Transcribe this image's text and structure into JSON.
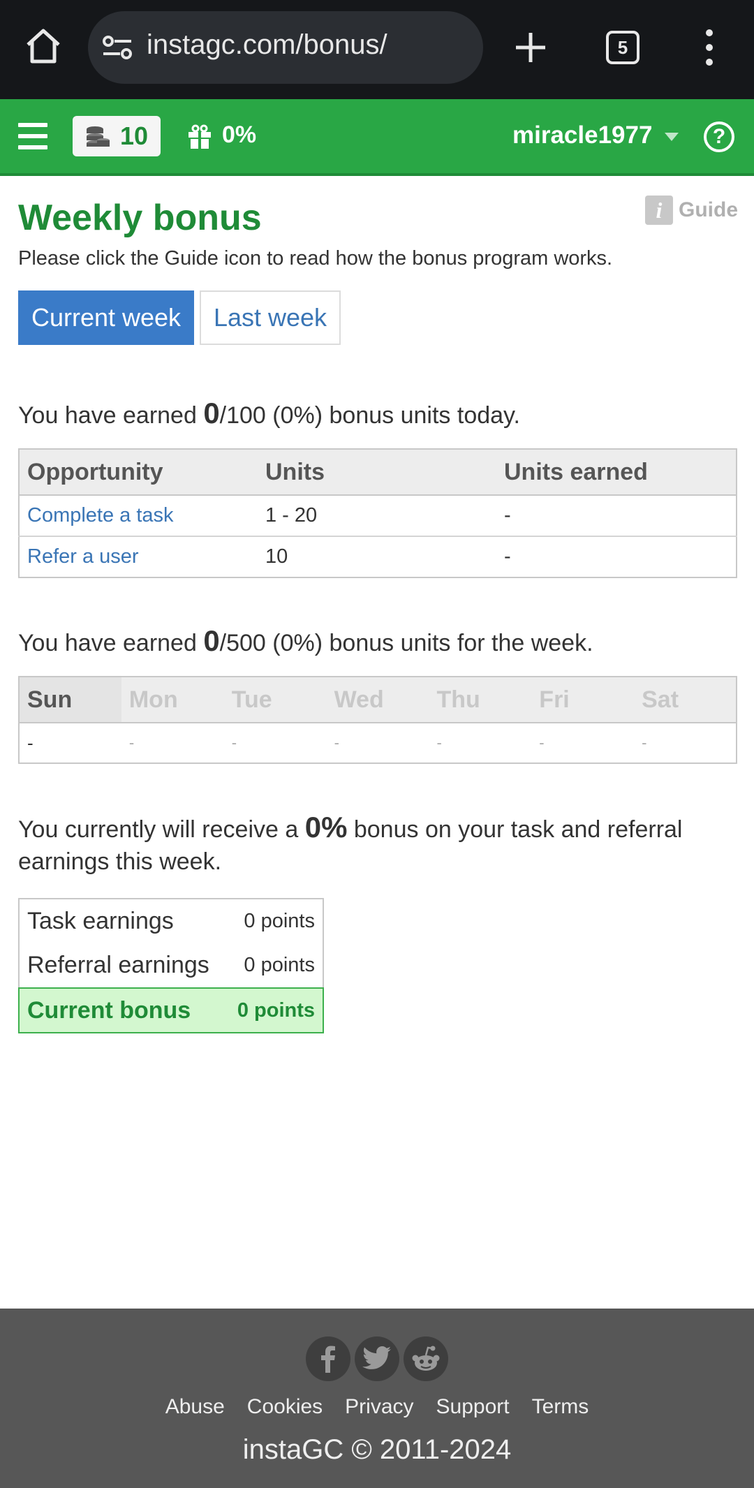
{
  "browser": {
    "url": "instagc.com/bonus/",
    "tab_count": "5"
  },
  "header": {
    "balance": "10",
    "bonus_percent": "0%",
    "username": "miracle1977",
    "help_symbol": "?"
  },
  "page": {
    "title": "Weekly bonus",
    "guide_icon_letter": "i",
    "guide_label": "Guide",
    "intro": "Please click the Guide icon to read how the bonus program works.",
    "tabs": [
      {
        "label": "Current week",
        "active": true
      },
      {
        "label": "Last week",
        "active": false
      }
    ]
  },
  "daily": {
    "prefix": "You have earned ",
    "earned": "0",
    "suffix": "/100 (0%) bonus units today.",
    "headers": [
      "Opportunity",
      "Units",
      "Units earned"
    ],
    "rows": [
      {
        "opportunity": "Complete a task",
        "units": "1 - 20",
        "earned": "-"
      },
      {
        "opportunity": "Refer a user",
        "units": "10",
        "earned": "-"
      }
    ]
  },
  "weekly": {
    "prefix": "You have earned ",
    "earned": "0",
    "suffix": "/500 (0%) bonus units for the week.",
    "days": [
      "Sun",
      "Mon",
      "Tue",
      "Wed",
      "Thu",
      "Fri",
      "Sat"
    ],
    "values": [
      "-",
      "-",
      "-",
      "-",
      "-",
      "-",
      "-"
    ],
    "active_day": "Sun"
  },
  "bonus": {
    "prefix": "You currently will receive a ",
    "percent": "0%",
    "suffix": " bonus on your task and referral earnings this week.",
    "rows": [
      {
        "label": "Task earnings",
        "value": "0 points"
      },
      {
        "label": "Referral earnings",
        "value": "0 points"
      },
      {
        "label": "Current bonus",
        "value": "0 points"
      }
    ]
  },
  "footer": {
    "social": [
      "facebook-icon",
      "twitter-icon",
      "reddit-icon"
    ],
    "links": [
      "Abuse",
      "Cookies",
      "Privacy",
      "Support",
      "Terms"
    ],
    "copyright": "instaGC © 2011-2024"
  },
  "colors": {
    "header_green": "#29a745",
    "title_green": "#1f8b37",
    "tab_blue": "#3a7bc8",
    "link_blue": "#3a75b5",
    "bonus_row_bg": "#d3f7cf",
    "footer_bg": "#575757"
  }
}
